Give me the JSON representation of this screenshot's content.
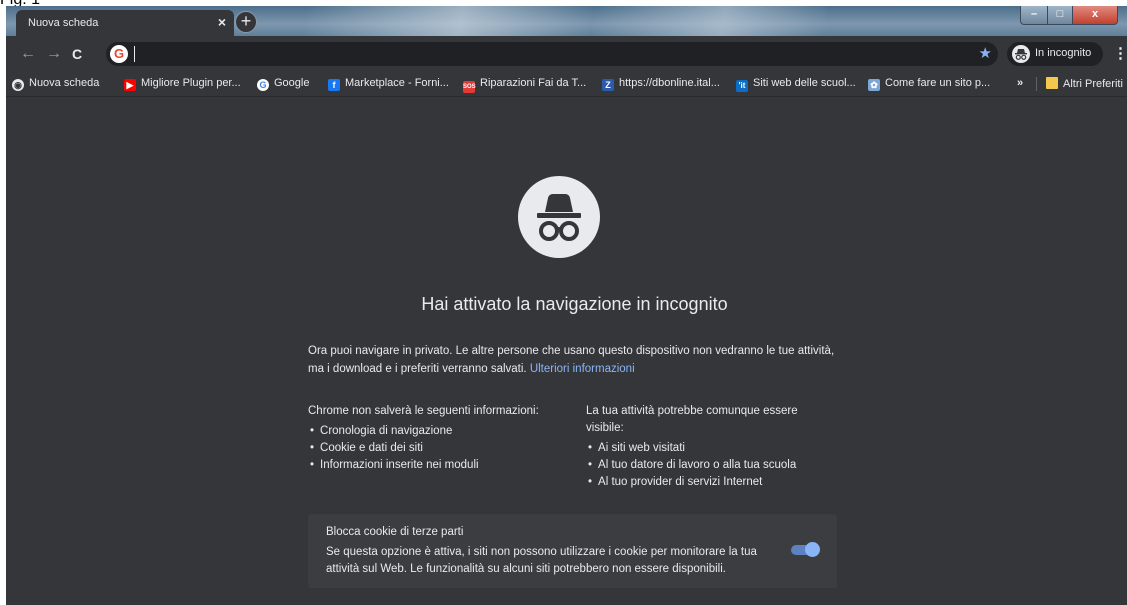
{
  "figure_label": "Fig. 1",
  "window": {
    "tab_title": "Nuova scheda",
    "tab_close": "×",
    "new_tab": "+",
    "min": "–",
    "max": "□",
    "close": "x"
  },
  "toolbar": {
    "back": "←",
    "forward": "→",
    "reload": "C",
    "omnibox_value": "",
    "star": "★",
    "profile_label": "In incognito",
    "menu": "⋮"
  },
  "bookmarks": {
    "items": [
      {
        "label": "Nuova scheda",
        "icon": "globe-icon",
        "color": "#e8eaed"
      },
      {
        "label": "Migliore Plugin per...",
        "icon": "youtube-icon",
        "color": "#ff0000"
      },
      {
        "label": "Google",
        "icon": "google-icon",
        "color": "#ffffff"
      },
      {
        "label": "Marketplace - Forni...",
        "icon": "facebook-icon",
        "color": "#1877f2"
      },
      {
        "label": "Riparazioni Fai da T...",
        "icon": "sos-icon",
        "color": "#e53935"
      },
      {
        "label": "https://dbonline.ital...",
        "icon": "z-icon",
        "color": "#2e5aac"
      },
      {
        "label": "Siti web delle scuol...",
        "icon": "it-icon",
        "color": "#0b6ec4"
      },
      {
        "label": "Come fare un sito p...",
        "icon": "site-icon",
        "color": "#7aa6d8"
      }
    ],
    "overflow": "»",
    "other_label": "Altri Preferiti"
  },
  "main": {
    "heading": "Hai attivato la navigazione in incognito",
    "intro_1": "Ora puoi navigare in privato. Le altre persone che usano questo dispositivo non vedranno le tue attività, ma i download e i preferiti verranno salvati.",
    "more_info_link": "Ulteriori informazioni",
    "left_title": "Chrome non salverà le seguenti informazioni:",
    "left_items": [
      "Cronologia di navigazione",
      "Cookie e dati dei siti",
      "Informazioni inserite nei moduli"
    ],
    "right_title": "La tua attività potrebbe comunque essere visibile:",
    "right_items": [
      "Ai siti web visitati",
      "Al tuo datore di lavoro o alla tua scuola",
      "Al tuo provider di servizi Internet"
    ],
    "cookie_card": {
      "title": "Blocca cookie di terze parti",
      "description": "Se questa opzione è attiva, i siti non possono utilizzare i cookie per monitorare la tua attività sul Web. Le funzionalità su alcuni siti potrebbero non essere disponibili.",
      "toggle_on": true
    }
  },
  "colors": {
    "background": "#35363a",
    "text": "#e8eaed",
    "link": "#8ab4f8",
    "card": "#3c3d41"
  }
}
